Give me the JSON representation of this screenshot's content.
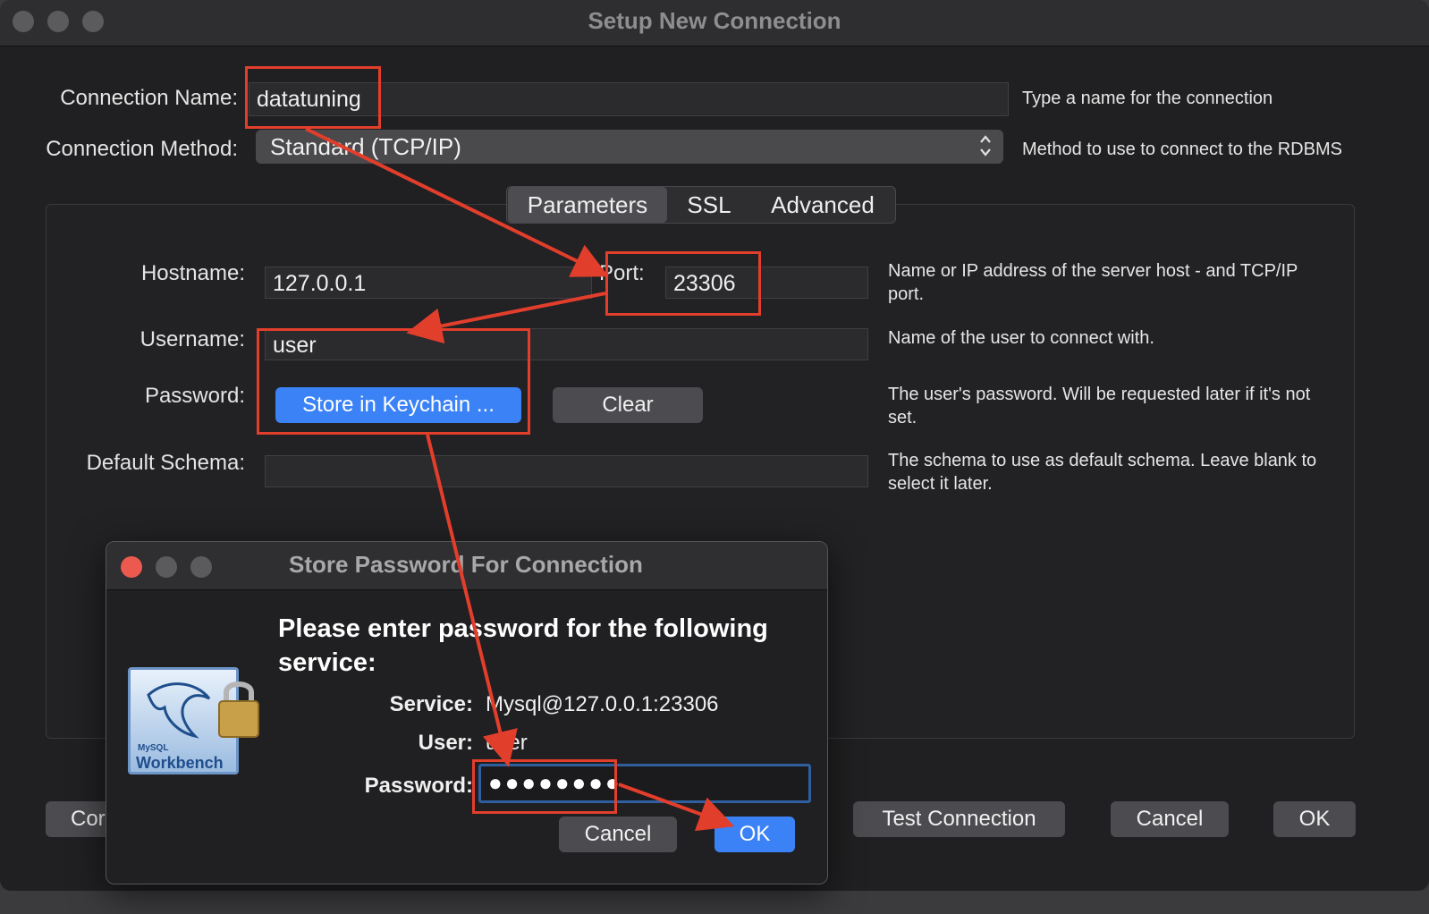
{
  "window": {
    "title": "Setup New Connection"
  },
  "connection_name": {
    "label": "Connection Name:",
    "value": "datatuning",
    "help": "Type a name for the connection"
  },
  "connection_method": {
    "label": "Connection Method:",
    "value": "Standard (TCP/IP)",
    "help": "Method to use to connect to the RDBMS"
  },
  "tabs": [
    "Parameters",
    "SSL",
    "Advanced"
  ],
  "hostname": {
    "label": "Hostname:",
    "value": "127.0.0.1"
  },
  "port": {
    "label": "Port:",
    "value": "23306"
  },
  "host_help": "Name or IP address of the server host - and TCP/IP port.",
  "username": {
    "label": "Username:",
    "value": "user",
    "help": "Name of the user to connect with."
  },
  "password": {
    "label": "Password:",
    "store_button": "Store in Keychain ...",
    "clear_button": "Clear",
    "help": "The user's password. Will be requested later if it's not set."
  },
  "default_schema": {
    "label": "Default Schema:",
    "value": "",
    "help": "The schema to use as default schema. Leave blank to select it later."
  },
  "footer": {
    "configure_partial": "Cor",
    "test_connection": "Test Connection",
    "cancel": "Cancel",
    "ok": "OK"
  },
  "dialog": {
    "title": "Store Password For Connection",
    "heading": "Please enter password for the following service:",
    "service_label": "Service:",
    "service_value": "Mysql@127.0.0.1:23306",
    "user_label": "User:",
    "user_value": "user",
    "password_label": "Password:",
    "password_masked": "●●●●●●●●",
    "cancel": "Cancel",
    "ok": "OK",
    "logo_text_small": "MySQL",
    "logo_text": "Workbench"
  },
  "colors": {
    "annotation_red": "#e23e2c",
    "accent_blue": "#3b82f6",
    "background": "#202022"
  },
  "icons": [
    "lock-icon",
    "dolphin-logo-icon",
    "up-down-chevron-icon"
  ]
}
